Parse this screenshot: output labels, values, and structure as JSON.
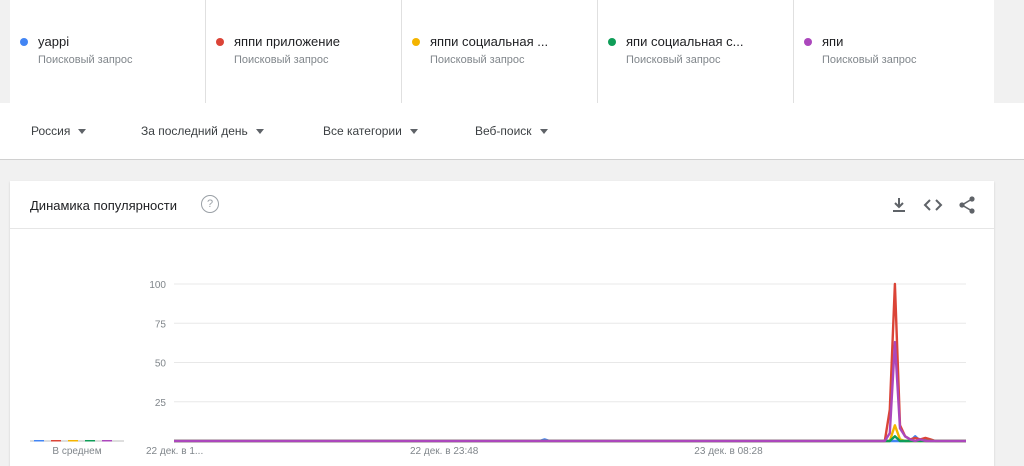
{
  "terms": [
    {
      "name": "yappi",
      "sub": "Поисковый запрос",
      "color": "#4285f4"
    },
    {
      "name": "яппи приложение",
      "sub": "Поисковый запрос",
      "color": "#db4437"
    },
    {
      "name": "яппи социальная ...",
      "sub": "Поисковый запрос",
      "color": "#f4b400"
    },
    {
      "name": "япи социальная с...",
      "sub": "Поисковый запрос",
      "color": "#0f9d58"
    },
    {
      "name": "япи",
      "sub": "Поисковый запрос",
      "color": "#ab47bc"
    }
  ],
  "filters": {
    "region": "Россия",
    "period": "За последний день",
    "category": "Все категории",
    "search_type": "Веб-поиск"
  },
  "card": {
    "title": "Динамика популярности",
    "help": "?"
  },
  "icons": [
    "download-icon",
    "embed-icon",
    "share-icon"
  ],
  "chart_data": {
    "type": "line",
    "ylim": [
      0,
      100
    ],
    "yticks": [
      25,
      50,
      75,
      100
    ],
    "xticks": [
      {
        "label": "22 дек. в 1...",
        "x": 0
      },
      {
        "label": "22 дек. в 23:48",
        "x": 52
      },
      {
        "label": "23 дек. в 08:28",
        "x": 108
      }
    ],
    "average_label": "В среднем",
    "average_values": [
      0,
      0,
      0,
      0,
      0
    ],
    "x_range": [
      0,
      156
    ],
    "series": [
      {
        "name": "yappi",
        "color": "#4285f4",
        "points": [
          [
            0,
            0
          ],
          [
            72,
            0
          ],
          [
            73,
            1
          ],
          [
            74,
            0
          ],
          [
            145,
            0
          ],
          [
            146,
            3
          ],
          [
            147,
            0
          ],
          [
            148,
            1
          ],
          [
            149,
            0
          ],
          [
            156,
            0
          ]
        ]
      },
      {
        "name": "яппи приложение",
        "color": "#db4437",
        "points": [
          [
            0,
            0
          ],
          [
            140,
            0
          ],
          [
            141,
            20
          ],
          [
            142,
            100
          ],
          [
            143,
            10
          ],
          [
            144,
            3
          ],
          [
            145,
            1
          ],
          [
            146,
            2
          ],
          [
            147,
            1
          ],
          [
            148,
            2
          ],
          [
            149,
            1
          ],
          [
            150,
            0
          ],
          [
            156,
            0
          ]
        ]
      },
      {
        "name": "яппи социальная ...",
        "color": "#f4b400",
        "points": [
          [
            0,
            0
          ],
          [
            141,
            0
          ],
          [
            142,
            10
          ],
          [
            143,
            1
          ],
          [
            144,
            0
          ],
          [
            156,
            0
          ]
        ]
      },
      {
        "name": "япи социальная с...",
        "color": "#0f9d58",
        "points": [
          [
            0,
            0
          ],
          [
            141,
            0
          ],
          [
            142,
            3
          ],
          [
            143,
            0
          ],
          [
            156,
            0
          ]
        ]
      },
      {
        "name": "япи",
        "color": "#ab47bc",
        "points": [
          [
            0,
            0
          ],
          [
            140,
            0
          ],
          [
            141,
            5
          ],
          [
            142,
            63
          ],
          [
            143,
            8
          ],
          [
            144,
            3
          ],
          [
            145,
            1
          ],
          [
            146,
            0
          ],
          [
            147,
            1
          ],
          [
            148,
            0
          ],
          [
            156,
            0
          ]
        ]
      }
    ]
  }
}
